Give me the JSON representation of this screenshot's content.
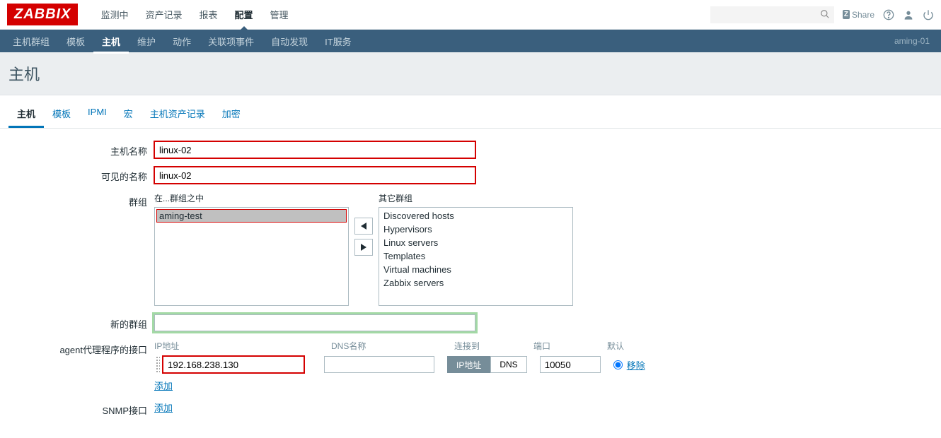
{
  "logo": "ZABBIX",
  "topmenu": {
    "items": [
      "监测中",
      "资产记录",
      "报表",
      "配置",
      "管理"
    ],
    "active_index": 3
  },
  "topright": {
    "share": "Share"
  },
  "subnav": {
    "items": [
      "主机群组",
      "模板",
      "主机",
      "维护",
      "动作",
      "关联项事件",
      "自动发现",
      "IT服务"
    ],
    "active_index": 2,
    "right_label": "aming-01"
  },
  "page_title": "主机",
  "tabs": {
    "items": [
      "主机",
      "模板",
      "IPMI",
      "宏",
      "主机资产记录",
      "加密"
    ],
    "active_index": 0
  },
  "form": {
    "hostname_label": "主机名称",
    "hostname_value": "linux-02",
    "visiblename_label": "可见的名称",
    "visiblename_value": "linux-02",
    "groups_label": "群组",
    "in_groups_label": "在...群组之中",
    "other_groups_label": "其它群组",
    "in_groups": [
      "aming-test"
    ],
    "other_groups": [
      "Discovered hosts",
      "Hypervisors",
      "Linux servers",
      "Templates",
      "Virtual machines",
      "Zabbix servers"
    ],
    "new_group_label": "新的群组",
    "new_group_value": "",
    "agent_iface_label": "agent代理程序的接口",
    "iface_headers": {
      "ip": "IP地址",
      "dns": "DNS名称",
      "connect": "连接到",
      "port": "端口",
      "default": "默认"
    },
    "iface": {
      "ip": "192.168.238.130",
      "dns": "",
      "connect_options": [
        "IP地址",
        "DNS"
      ],
      "connect_active": 0,
      "port": "10050",
      "remove": "移除"
    },
    "add_label": "添加",
    "snmp_label": "SNMP接口",
    "snmp_add": "添加"
  }
}
